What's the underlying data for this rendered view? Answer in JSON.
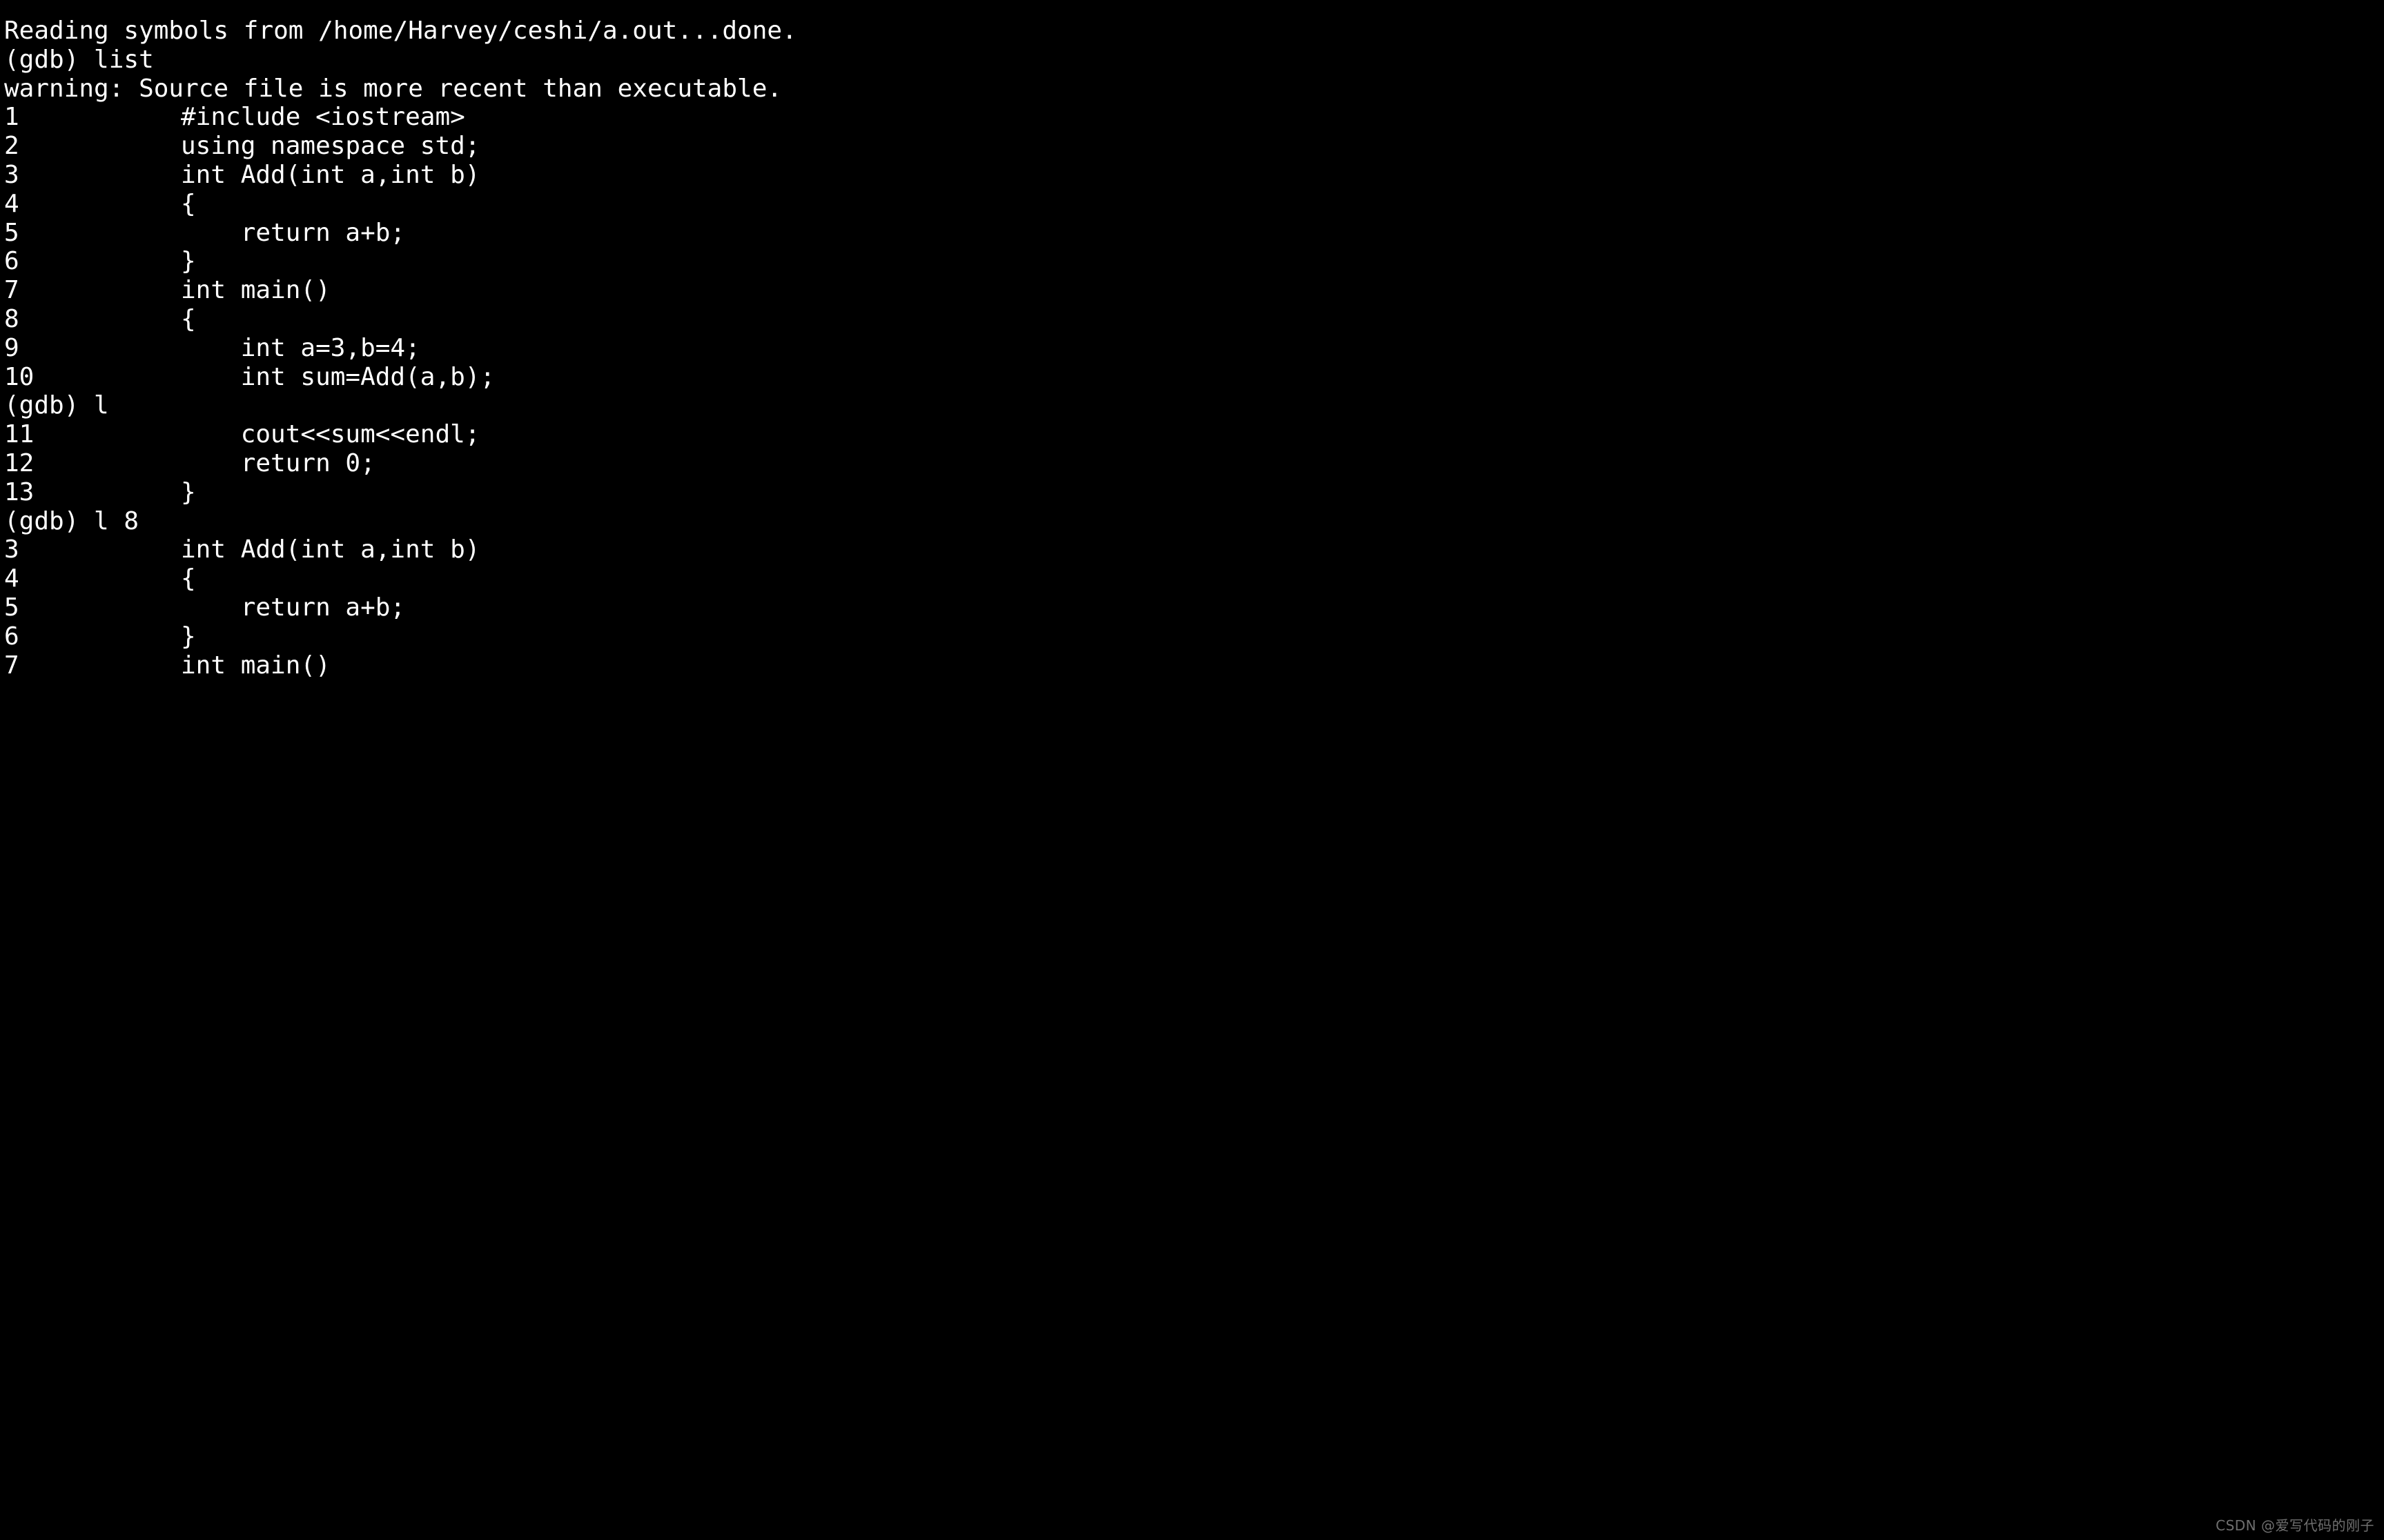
{
  "terminal": {
    "background_color": "#000000",
    "text_color": "#ffffff",
    "lines": [
      {
        "type": "output",
        "gutter": "",
        "text": "Reading symbols from /home/Harvey/ceshi/a.out...done."
      },
      {
        "type": "prompt",
        "gutter": "",
        "text": "(gdb) list"
      },
      {
        "type": "warning",
        "gutter": "",
        "text": "warning: Source file is more recent than executable."
      },
      {
        "type": "source",
        "gutter": "1\t",
        "text": "#include <iostream>"
      },
      {
        "type": "source",
        "gutter": "2\t",
        "text": "using namespace std;"
      },
      {
        "type": "source",
        "gutter": "3\t",
        "text": "int Add(int a,int b)"
      },
      {
        "type": "source",
        "gutter": "4\t",
        "text": "{"
      },
      {
        "type": "source",
        "gutter": "5\t",
        "text": "    return a+b;"
      },
      {
        "type": "source",
        "gutter": "6\t",
        "text": "}"
      },
      {
        "type": "source",
        "gutter": "7\t",
        "text": "int main()"
      },
      {
        "type": "source",
        "gutter": "8\t",
        "text": "{"
      },
      {
        "type": "source",
        "gutter": "9\t",
        "text": "    int a=3,b=4;"
      },
      {
        "type": "source",
        "gutter": "10\t",
        "text": "    int sum=Add(a,b);"
      },
      {
        "type": "prompt",
        "gutter": "",
        "text": "(gdb) l"
      },
      {
        "type": "source",
        "gutter": "11\t",
        "text": "    cout<<sum<<endl;"
      },
      {
        "type": "source",
        "gutter": "12\t",
        "text": "    return 0;"
      },
      {
        "type": "source",
        "gutter": "13\t",
        "text": "}"
      },
      {
        "type": "prompt",
        "gutter": "",
        "text": "(gdb) l 8"
      },
      {
        "type": "source",
        "gutter": "3\t",
        "text": "int Add(int a,int b)"
      },
      {
        "type": "source",
        "gutter": "4\t",
        "text": "{"
      },
      {
        "type": "source",
        "gutter": "5\t",
        "text": "    return a+b;"
      },
      {
        "type": "source",
        "gutter": "6\t",
        "text": "}"
      },
      {
        "type": "source",
        "gutter": "7\t",
        "text": "int main()"
      }
    ]
  },
  "watermark": {
    "text": "CSDN @爱写代码的刚子",
    "color": "#6f6f6f"
  }
}
